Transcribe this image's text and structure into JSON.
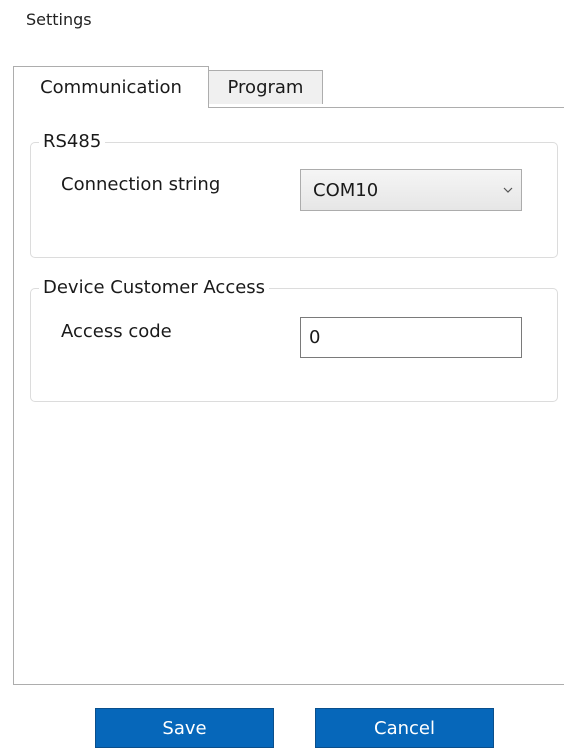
{
  "window": {
    "title": "Settings"
  },
  "tabs": [
    {
      "label": "Communication",
      "selected": true
    },
    {
      "label": "Program",
      "selected": false
    }
  ],
  "rs485": {
    "group_label": "RS485",
    "connection_label": "Connection string",
    "connection_value": "COM10",
    "dropdown_icon": "chevron-down-icon"
  },
  "device_access": {
    "group_label": "Device Customer Access",
    "access_label": "Access code",
    "access_value": "0"
  },
  "buttons": {
    "save_label": "Save",
    "cancel_label": "Cancel"
  },
  "colors": {
    "button_bg": "#0667ba",
    "button_text": "#ffffff"
  }
}
